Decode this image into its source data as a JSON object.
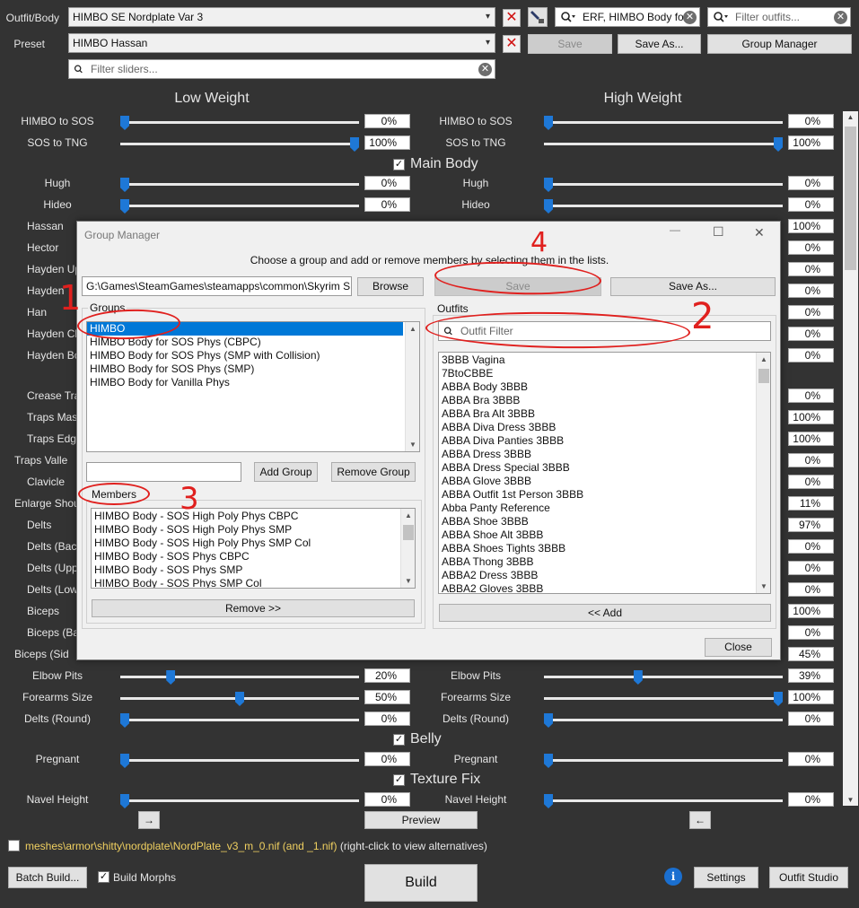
{
  "top": {
    "outfit_label": "Outfit/Body",
    "outfit_value": "HIMBO SE Nordplate Var 3",
    "preset_label": "Preset",
    "preset_value": "HIMBO Hassan",
    "search_filter_value": "ERF, HIMBO Body fo",
    "outfit_filter_placeholder": "Filter outfits...",
    "slider_filter_placeholder": "Filter sliders...",
    "save_label": "Save",
    "save_as_label": "Save As...",
    "group_manager_label": "Group Manager"
  },
  "columns": {
    "low": "Low Weight",
    "high": "High Weight"
  },
  "groups": {
    "main_body": "Main Body",
    "belly": "Belly",
    "texture_fix": "Texture Fix"
  },
  "sliders_top": [
    {
      "name": "HIMBO to SOS",
      "low": "0%",
      "high": "0%",
      "low_frac": 0.0,
      "high_frac": 0.0
    },
    {
      "name": "SOS to TNG",
      "low": "100%",
      "high": "100%",
      "low_frac": 1.0,
      "high_frac": 1.0
    }
  ],
  "sliders_main": [
    {
      "name": "Hugh",
      "low": "0%",
      "high": "0%",
      "low_frac": 0.0,
      "high_frac": 0.0
    },
    {
      "name": "Hideo",
      "low": "0%",
      "high": "0%",
      "low_frac": 0.0,
      "high_frac": 0.0
    }
  ],
  "sliders_hidden_left": [
    "Hassan",
    "Hector",
    "Hayden Up",
    "Hayden",
    "Han",
    "Hayden Cl",
    "Hayden Bo",
    "Crease Tra",
    "Traps Mas",
    "Traps Edg",
    "Traps Valle",
    "Clavicle",
    "Enlarge Shou",
    "Delts",
    "Delts (Bac",
    "Delts (Upp",
    "Delts (Low",
    "Biceps",
    "Biceps (Ba",
    "Biceps (Sid"
  ],
  "values_hidden_right": [
    "100%",
    "0%",
    "0%",
    "0%",
    "0%",
    "0%",
    "0%",
    "0%",
    "100%",
    "100%",
    "0%",
    "0%",
    "11%",
    "97%",
    "0%",
    "0%",
    "0%",
    "100%",
    "0%",
    "45%"
  ],
  "sliders_bottom": [
    {
      "name": "Elbow Pits",
      "low": "20%",
      "high": "39%",
      "low_frac": 0.2,
      "high_frac": 0.39
    },
    {
      "name": "Forearms Size",
      "low": "50%",
      "high": "100%",
      "low_frac": 0.5,
      "high_frac": 1.0
    },
    {
      "name": "Delts (Round)",
      "low": "0%",
      "high": "0%",
      "low_frac": 0.0,
      "high_frac": 0.0
    }
  ],
  "slider_belly": {
    "name": "Pregnant",
    "low": "0%",
    "high": "0%"
  },
  "slider_texture": {
    "name": "Navel Height",
    "low": "0%",
    "high": "0%"
  },
  "bottom": {
    "arrow_right": "→",
    "arrow_left": "←",
    "preview_label": "Preview",
    "mesh_path": "meshes\\armor\\shitty\\nordplate\\NordPlate_v3_m_0.nif (and _1.nif)",
    "mesh_hint": "(right-click to view alternatives)",
    "batch_build": "Batch Build...",
    "build_morphs": "Build Morphs",
    "build": "Build",
    "info_icon": "i",
    "settings": "Settings",
    "outfit_studio": "Outfit Studio"
  },
  "dialog": {
    "title": "Group Manager",
    "instruction": "Choose a group and add or remove members by selecting them in the lists.",
    "path": "G:\\Games\\SteamGames\\steamapps\\common\\Skyrim S",
    "browse": "Browse",
    "save": "Save",
    "save_as": "Save As...",
    "groups_label": "Groups",
    "groups": [
      "HIMBO",
      "HIMBO Body for SOS Phys (CBPC)",
      "HIMBO Body for SOS Phys (SMP with Collision)",
      "HIMBO Body for SOS Phys (SMP)",
      "HIMBO Body for Vanilla Phys"
    ],
    "add_group": "Add Group",
    "remove_group": "Remove Group",
    "members_label": "Members",
    "members": [
      "HIMBO Body - SOS High Poly Phys CBPC",
      "HIMBO Body - SOS High Poly Phys SMP",
      "HIMBO Body - SOS High Poly Phys SMP Col",
      "HIMBO Body - SOS Phys CBPC",
      "HIMBO Body - SOS Phys SMP",
      "HIMBO Body - SOS Phys SMP Col"
    ],
    "remove": "Remove >>",
    "outfits_label": "Outfits",
    "outfit_filter_placeholder": "Outfit Filter",
    "outfits": [
      "3BBB Vagina",
      "7BtoCBBE",
      "ABBA Body 3BBB",
      "ABBA Bra 3BBB",
      "ABBA Bra Alt 3BBB",
      "ABBA Diva Dress 3BBB",
      "ABBA Diva Panties 3BBB",
      "ABBA Dress 3BBB",
      "ABBA Dress Special 3BBB",
      "ABBA Glove 3BBB",
      "ABBA Outfit 1st Person 3BBB",
      "Abba Panty Reference",
      "ABBA Shoe 3BBB",
      "ABBA Shoe Alt 3BBB",
      "ABBA Shoes Tights 3BBB",
      "ABBA Thong 3BBB",
      "ABBA2 Dress 3BBB",
      "ABBA2 Gloves 3BBB"
    ],
    "add": "<< Add",
    "close": "Close",
    "minimize": "—",
    "maximize": "☐",
    "close_x": "✕"
  },
  "annotations": {
    "n1": "1",
    "n2": "2",
    "n3": "3",
    "n4": "4"
  }
}
